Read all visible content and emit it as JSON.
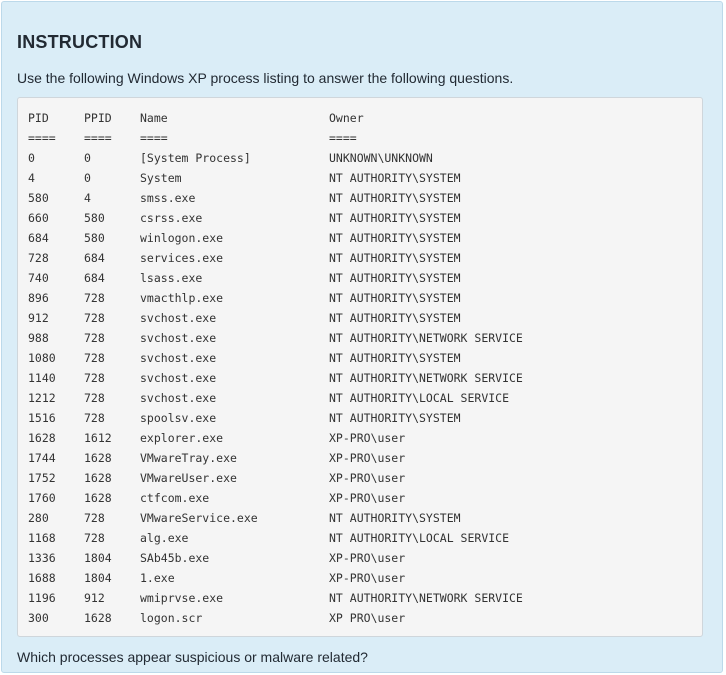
{
  "heading": "INSTRUCTION",
  "intro": "Use the following Windows XP process listing to answer the following questions.",
  "listing": {
    "columns": [
      "PID",
      "PPID",
      "Name",
      "Owner"
    ],
    "separators": [
      "====",
      "====",
      "====",
      "===="
    ],
    "rows": [
      [
        "0",
        "0",
        "[System Process]",
        "UNKNOWN\\UNKNOWN"
      ],
      [
        "4",
        "0",
        "System",
        "NT AUTHORITY\\SYSTEM"
      ],
      [
        "580",
        "4",
        "smss.exe",
        "NT AUTHORITY\\SYSTEM"
      ],
      [
        "660",
        "580",
        "csrss.exe",
        "NT AUTHORITY\\SYSTEM"
      ],
      [
        "684",
        "580",
        "winlogon.exe",
        "NT AUTHORITY\\SYSTEM"
      ],
      [
        "728",
        "684",
        "services.exe",
        "NT AUTHORITY\\SYSTEM"
      ],
      [
        "740",
        "684",
        "lsass.exe",
        "NT AUTHORITY\\SYSTEM"
      ],
      [
        "896",
        "728",
        "vmacthlp.exe",
        "NT AUTHORITY\\SYSTEM"
      ],
      [
        "912",
        "728",
        "svchost.exe",
        "NT AUTHORITY\\SYSTEM"
      ],
      [
        "988",
        "728",
        "svchost.exe",
        "NT AUTHORITY\\NETWORK SERVICE"
      ],
      [
        "1080",
        "728",
        "svchost.exe",
        "NT AUTHORITY\\SYSTEM"
      ],
      [
        "1140",
        "728",
        "svchost.exe",
        "NT AUTHORITY\\NETWORK SERVICE"
      ],
      [
        "1212",
        "728",
        "svchost.exe",
        "NT AUTHORITY\\LOCAL SERVICE"
      ],
      [
        "1516",
        "728",
        "spoolsv.exe",
        "NT AUTHORITY\\SYSTEM"
      ],
      [
        "1628",
        "1612",
        "explorer.exe",
        "XP-PRO\\user"
      ],
      [
        "1744",
        "1628",
        "VMwareTray.exe",
        "XP-PRO\\user"
      ],
      [
        "1752",
        "1628",
        "VMwareUser.exe",
        "XP-PRO\\user"
      ],
      [
        "1760",
        "1628",
        "ctfcom.exe",
        "XP-PRO\\user"
      ],
      [
        "280",
        "728",
        "VMwareService.exe",
        "NT AUTHORITY\\SYSTEM"
      ],
      [
        "1168",
        "728",
        "alg.exe",
        "NT AUTHORITY\\LOCAL SERVICE"
      ],
      [
        "1336",
        "1804",
        "SAb45b.exe",
        "XP-PRO\\user"
      ],
      [
        "1688",
        "1804",
        "1.exe",
        "XP-PRO\\user"
      ],
      [
        "1196",
        "912",
        "wmiprvse.exe",
        "NT AUTHORITY\\NETWORK SERVICE"
      ],
      [
        "300",
        "1628",
        "logon.scr",
        "XP PRO\\user"
      ]
    ]
  },
  "question": "Which processes appear suspicious or malware related?"
}
